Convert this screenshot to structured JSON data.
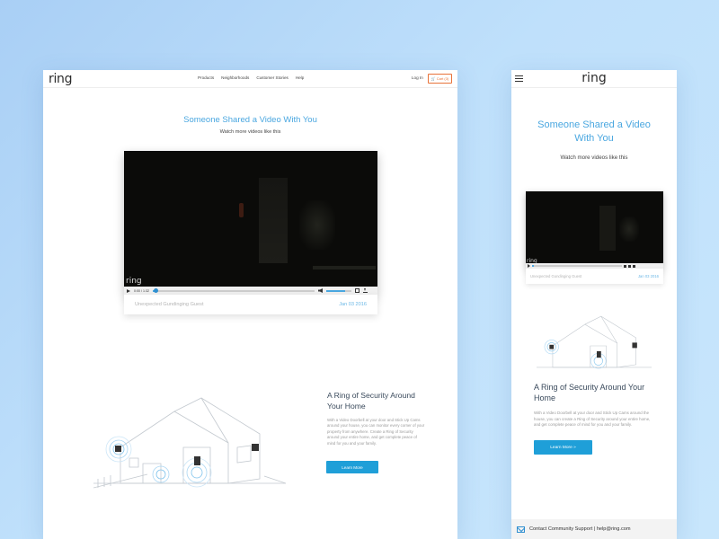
{
  "desktop": {
    "logo": "ring",
    "nav": [
      "Products",
      "Neighborhoods",
      "Customer Stories",
      "Help"
    ],
    "login": "Log In",
    "cart": "🛒 Cart (3)",
    "headline": "Someone Shared a Video With You",
    "subheadline": "Watch more videos like this",
    "video": {
      "watermark": "ring",
      "time": "0:00 / 1:32",
      "progress": 0.02,
      "volume": 0.75
    },
    "caption": {
      "title": "Unexpected Gundinging Guest",
      "date": "Jan 03 2016"
    },
    "feature": {
      "title": "A Ring of Security Around Your Home",
      "body": "With a Video Doorbell at your door and Stick Up Cams around your house, you can monitor every corner of your property from anywhere. Create a Ring of Security around your entire home, and get complete peace of mind for you and your family.",
      "button": "Learn More"
    }
  },
  "mobile": {
    "logo": "ring",
    "headline": "Someone Shared a Video With You",
    "subheadline": "Watch more videos like this",
    "video": {
      "watermark": "ring",
      "progress": 0.02
    },
    "caption": {
      "title": "Unexpected Gundinging Guest",
      "date": "Jan 03 2016"
    },
    "feature": {
      "title": "A Ring of Security Around Your Home",
      "body": "With a Video Doorbell at your door and Stick Up Cams around the house, you can create a Ring of Security around your entire home, and get complete peace of mind for you and your family.",
      "button": "Learn More »"
    },
    "footer": "Contact Community Support | help@ring.com"
  },
  "colors": {
    "accent": "#4aa7e0",
    "button": "#1f9fd8",
    "cart": "#e8733a",
    "background": "#bfe0fb"
  },
  "icons": [
    "hamburger-menu-icon",
    "play-icon",
    "volume-icon",
    "fullscreen-icon",
    "download-icon",
    "mail-icon"
  ]
}
